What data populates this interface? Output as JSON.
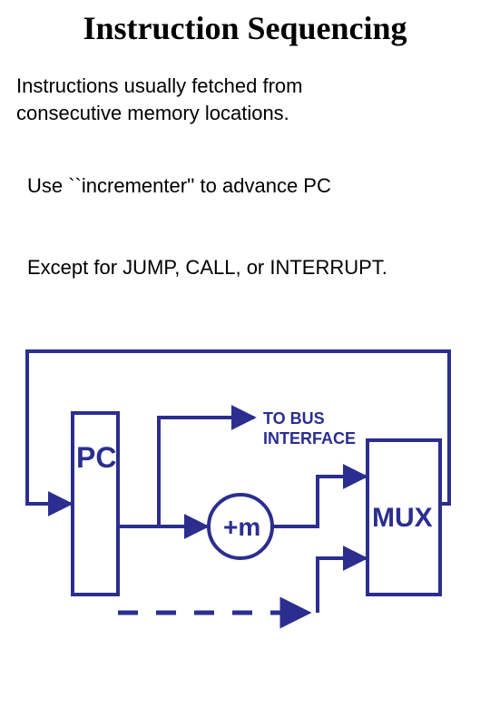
{
  "title": "Instruction Sequencing",
  "paragraphs": {
    "p1_line1": "  Instructions usually fetched from",
    "p1_line2": "consecutive memory locations.",
    "p2": "Use ``incrementer'' to advance PC",
    "p3": "Except for JUMP, CALL, or INTERRUPT."
  },
  "diagram": {
    "pc_label": "PC",
    "inc_label": "+m",
    "mux_label": "MUX",
    "bus_label": "TO BUS\nINTERFACE"
  },
  "colors": {
    "stroke": "#2b2e8f",
    "fill_white": "#ffffff"
  }
}
